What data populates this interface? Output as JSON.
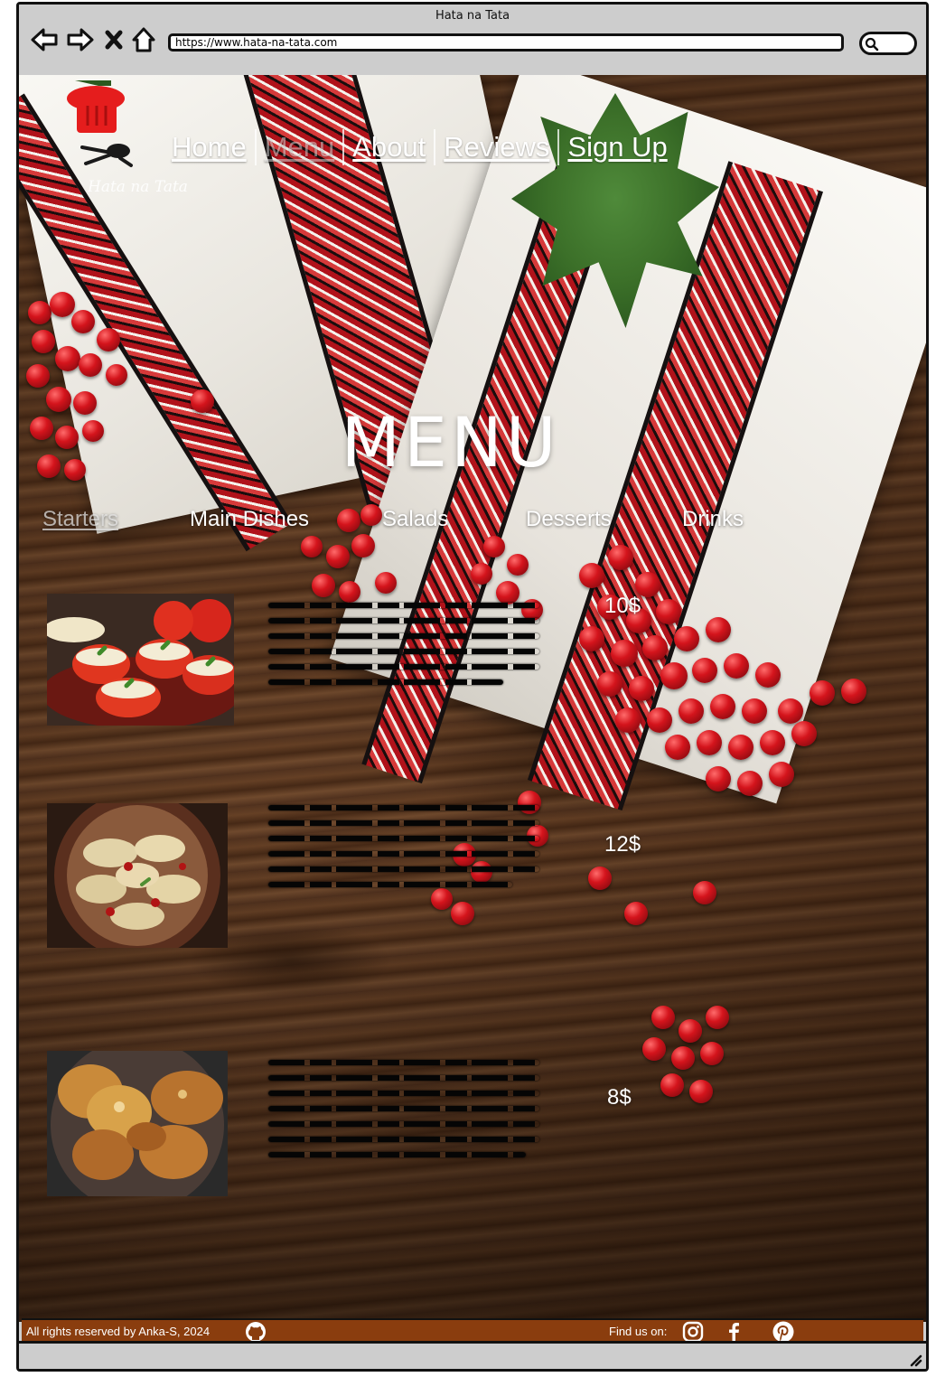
{
  "window": {
    "title": "Hata na Tata",
    "url": "https://www.hata-na-tata.com"
  },
  "site": {
    "logo_text": "Hata na Tata",
    "nav": [
      {
        "label": "Home",
        "active": false
      },
      {
        "label": "Menu",
        "active": true
      },
      {
        "label": "About",
        "active": false
      },
      {
        "label": "Reviews",
        "active": false
      },
      {
        "label": "Sign Up",
        "active": false
      }
    ]
  },
  "menu": {
    "title": "MENU",
    "categories": [
      {
        "label": "Starters",
        "active": true
      },
      {
        "label": "Main Dishes",
        "active": false
      },
      {
        "label": "Salads",
        "active": false
      },
      {
        "label": "Desserts",
        "active": false
      },
      {
        "label": "Drinks",
        "active": false
      }
    ],
    "items": [
      {
        "image": "stuffed-tomatoes",
        "price": "10$",
        "description_lines": 6
      },
      {
        "image": "varenyky-dumplings",
        "price": "12$",
        "description_lines": 6
      },
      {
        "image": "potato-pancakes",
        "price": "8$",
        "description_lines": 7
      }
    ]
  },
  "footer": {
    "copyright": "All rights reserved by Anka-S, 2024",
    "find_us": "Find us on:",
    "social_icons": [
      "instagram-icon",
      "facebook-icon",
      "pinterest-icon"
    ],
    "color": "#8a3d0e"
  },
  "colors": {
    "accent_red": "#c8141c",
    "text": "#ffffff",
    "wood": "#5b3a22"
  }
}
